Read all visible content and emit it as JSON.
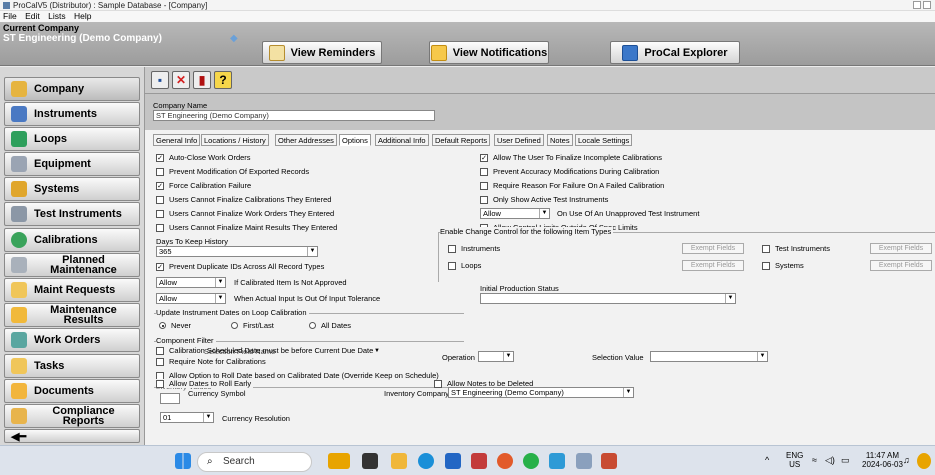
{
  "window": {
    "title": "ProCalV5 (Distributor) : Sample Database - [Company]"
  },
  "menu": [
    "File",
    "Edit",
    "Lists",
    "Help"
  ],
  "company_bar": {
    "label": "Current Company",
    "value": "ST Engineering (Demo Company)",
    "buttons": [
      "View Reminders",
      "View Notifications",
      "ProCal Explorer"
    ]
  },
  "sidebar": [
    "Company",
    "Instruments",
    "Loops",
    "Equipment",
    "Systems",
    "Test Instruments",
    "Calibrations",
    "Planned Maintenance",
    "Maint Requests",
    "Maintenance Results",
    "Work Orders",
    "Tasks",
    "Documents",
    "Compliance Reports"
  ],
  "toolbar_icons": [
    "save-icon",
    "delete-icon",
    "exit-icon",
    "help-icon"
  ],
  "form": {
    "company_name_label": "Company Name",
    "company_name_value": "ST Engineering (Demo Company)"
  },
  "tabs": [
    "General Info",
    "Locations / History",
    "Other Addresses",
    "Options",
    "Additional Info",
    "Default Reports",
    "User Defined",
    "Notes",
    "Locale Settings"
  ],
  "options": {
    "left_checks": [
      {
        "label": "Auto-Close Work Orders",
        "checked": true
      },
      {
        "label": "Prevent Modification Of Exported Records",
        "checked": false
      },
      {
        "label": "Force Calibration Failure",
        "checked": true
      },
      {
        "label": "Users Cannot Finalize Calibrations They Entered",
        "checked": false
      },
      {
        "label": "Users Cannot Finalize Work Orders They Entered",
        "checked": false
      },
      {
        "label": "Users Cannot Finalize Maint Results They Entered",
        "checked": false
      }
    ],
    "right_checks": [
      {
        "label": "Allow The User To Finalize Incomplete Calibrations",
        "checked": true
      },
      {
        "label": "Prevent Accuracy Modifications During Calibration",
        "checked": false
      },
      {
        "label": "Require Reason For Failure On A Failed Calibration",
        "checked": false
      },
      {
        "label": "Only Show Active Test Instruments",
        "checked": false
      }
    ],
    "unapproved_select": "Allow",
    "unapproved_label": "On Use Of An Unapproved Test Instrument",
    "allow_control_limits": "Allow Control Limits Outside Of Spec Limits",
    "days_label": "Days To Keep History",
    "days_value": "365",
    "prevent_dup": "Prevent Duplicate IDs Across All Record Types",
    "not_approved_select": "Allow",
    "not_approved_label": "If Calibrated Item Is Not Approved",
    "tolerance_select": "Allow",
    "tolerance_label": "When Actual Input Is Out Of Input Tolerance",
    "change_control_title": "Enable Change Control for the following Item Types",
    "cc_items": [
      "Instruments",
      "Loops",
      "Test Instruments",
      "Systems"
    ],
    "exempt_label": "Exempt Fields",
    "initial_prod_label": "Initial Production Status",
    "update_loop_title": "Update Instrument Dates on Loop Calibration",
    "radios": [
      "Never",
      "First/Last",
      "All Dates"
    ],
    "component_filter_title": "Component Filter",
    "selection_field_name": "Selection Field Name",
    "operation_label": "Operation",
    "selection_value_label": "Selection Value",
    "cal_scheduled": "Calibration Scheduled Date must be before Current Due Date",
    "require_note": "Require Note for Calibrations",
    "roll_date": "Allow Option to Roll Date based on Calibrated Date (Override Keep on Schedule)",
    "inventory_values": "Inventory Values",
    "roll_early": "Allow Dates to Roll Early",
    "notes_deleted": "Allow Notes to be Deleted",
    "currency_symbol": "Currency Symbol",
    "inventory_company_label": "Inventory Company",
    "inventory_company_value": "ST Engineering (Demo Company)",
    "currency_res_value": "01",
    "currency_res_label": "Currency Resolution"
  },
  "taskbar": {
    "search": "Search",
    "lang": "ENG",
    "region": "US",
    "time": "11:47 AM",
    "date": "2024-06-03"
  }
}
